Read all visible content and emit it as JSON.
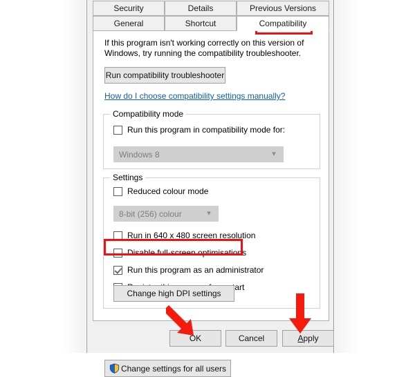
{
  "dialog": {
    "tabs_row1": [
      {
        "label": "Security",
        "active": false
      },
      {
        "label": "Details",
        "active": false
      },
      {
        "label": "Previous Versions",
        "active": false
      }
    ],
    "tabs_row2": [
      {
        "label": "General",
        "active": false
      },
      {
        "label": "Shortcut",
        "active": false
      },
      {
        "label": "Compatibility",
        "active": true
      }
    ],
    "intro_text": "If this program isn't working correctly on this version of Windows, try running the compatibility troubleshooter.",
    "troubleshooter_button": "Run compatibility troubleshooter",
    "help_link": "How do I choose compatibility settings manually?",
    "compatibility_mode": {
      "title": "Compatibility mode",
      "checkbox_label": "Run this program in compatibility mode for:",
      "checkbox_checked": false,
      "dropdown_value": "Windows 8",
      "dropdown_enabled": false
    },
    "settings": {
      "title": "Settings",
      "reduced_colour_label": "Reduced colour mode",
      "reduced_colour_checked": false,
      "colour_depth_value": "8-bit (256) colour",
      "colour_depth_enabled": false,
      "checkboxes": [
        {
          "label": "Run in 640 x 480 screen resolution",
          "checked": false
        },
        {
          "label": "Disable full-screen optimisations",
          "checked": false
        },
        {
          "label": "Run this program as an administrator",
          "checked": true
        },
        {
          "label": "Register this program for restart",
          "checked": false
        }
      ],
      "dpi_button": "Change high DPI settings"
    },
    "change_all_users_button": "Change settings for all users",
    "footer": {
      "ok": "OK",
      "cancel": "Cancel",
      "apply_underlined": "A",
      "apply_rest": "pply"
    }
  },
  "annotations": {
    "highlight_color": "#ee1111",
    "boxes": [
      {
        "target": "Compatibility tab"
      },
      {
        "target": "Run this program as an administrator"
      }
    ],
    "arrows": [
      {
        "points_to": "OK"
      },
      {
        "points_to": "Apply"
      }
    ]
  }
}
